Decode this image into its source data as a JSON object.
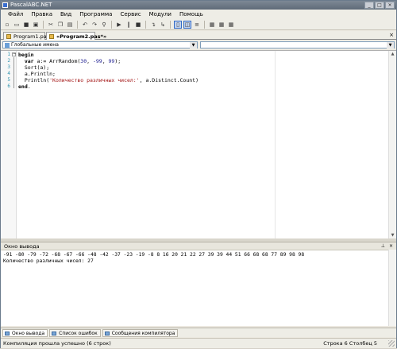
{
  "window": {
    "title": "PascalABC.NET"
  },
  "menu": [
    "Файл",
    "Правка",
    "Вид",
    "Программа",
    "Сервис",
    "Модули",
    "Помощь"
  ],
  "toolbar": [
    {
      "icon": "new-file-icon",
      "glyph": "▫"
    },
    {
      "icon": "open-folder-icon",
      "glyph": "▭"
    },
    {
      "icon": "save-icon",
      "glyph": "■"
    },
    {
      "icon": "save-all-icon",
      "glyph": "▣"
    },
    {
      "sep": true
    },
    {
      "icon": "cut-icon",
      "glyph": "✂"
    },
    {
      "icon": "copy-icon",
      "glyph": "❐"
    },
    {
      "icon": "paste-icon",
      "glyph": "▤"
    },
    {
      "sep": true
    },
    {
      "icon": "undo-icon",
      "glyph": "↶"
    },
    {
      "icon": "redo-icon",
      "glyph": "↷"
    },
    {
      "icon": "find-icon",
      "glyph": "⚲"
    },
    {
      "sep": true
    },
    {
      "icon": "run-icon",
      "glyph": "▶"
    },
    {
      "icon": "pause-icon",
      "glyph": "‖"
    },
    {
      "icon": "stop-icon",
      "glyph": "■"
    },
    {
      "sep": true
    },
    {
      "icon": "step-into-icon",
      "glyph": "↴"
    },
    {
      "icon": "step-over-icon",
      "glyph": "↳"
    },
    {
      "sep": true
    },
    {
      "icon": "layout-one-icon",
      "glyph": "▯",
      "active": true
    },
    {
      "icon": "layout-two-icon",
      "glyph": "◫",
      "active": true
    },
    {
      "icon": "format-icon",
      "glyph": "≡"
    },
    {
      "sep": true
    },
    {
      "icon": "window-1-icon",
      "glyph": "▦"
    },
    {
      "icon": "window-2-icon",
      "glyph": "▦"
    },
    {
      "icon": "window-3-icon",
      "glyph": "▦"
    }
  ],
  "tabs": [
    {
      "label": "Program1.pas*",
      "active": false
    },
    {
      "label": "«Program2.pas*»",
      "active": true
    }
  ],
  "tab_close": "×",
  "navbar": {
    "scope": "Глобальные имена",
    "member": ""
  },
  "code": [
    {
      "n": "1",
      "parts": [
        {
          "t": "begin",
          "c": "kw"
        }
      ]
    },
    {
      "n": "2",
      "parts": [
        {
          "t": "  var",
          "c": "kw"
        },
        {
          "t": " a:= ArrRandom(",
          "c": "nm"
        },
        {
          "t": "30",
          "c": "num"
        },
        {
          "t": ", ",
          "c": "nm"
        },
        {
          "t": "-99",
          "c": "num"
        },
        {
          "t": ", ",
          "c": "nm"
        },
        {
          "t": "99",
          "c": "num"
        },
        {
          "t": ");",
          "c": "nm"
        }
      ]
    },
    {
      "n": "3",
      "parts": [
        {
          "t": "  Sort(a);",
          "c": "nm"
        }
      ]
    },
    {
      "n": "4",
      "parts": [
        {
          "t": "  a.Println;",
          "c": "nm"
        }
      ]
    },
    {
      "n": "5",
      "parts": [
        {
          "t": "  Println(",
          "c": "nm"
        },
        {
          "t": "'Количество различных чисел:'",
          "c": "str"
        },
        {
          "t": ", a.Distinct.Count)",
          "c": "nm"
        }
      ]
    },
    {
      "n": "6",
      "parts": [
        {
          "t": "end",
          "c": "kw"
        },
        {
          "t": ".",
          "c": "nm"
        }
      ]
    }
  ],
  "output_panel": {
    "title": "Окно вывода",
    "pin": "⊥",
    "close": "×",
    "lines": [
      "-91 -80 -79 -72 -68 -67 -66 -48 -42 -37 -23 -19 -8 8 16 20 21 22 27 39 39 44 51 66 68 68 77 89 98 98",
      "Количество различных чисел: 27"
    ]
  },
  "bottom_tabs": [
    {
      "label": "Окно вывода",
      "icon": "output-window-icon",
      "active": true
    },
    {
      "label": "Список ошибок",
      "icon": "error-list-icon",
      "active": false
    },
    {
      "label": "Сообщения компилятора",
      "icon": "compiler-messages-icon",
      "active": false
    }
  ],
  "status": {
    "message": "Компиляция прошла успешно (6 строк)",
    "row_label": "Строка",
    "row": "6",
    "col_label": "Столбец",
    "col": "5"
  }
}
